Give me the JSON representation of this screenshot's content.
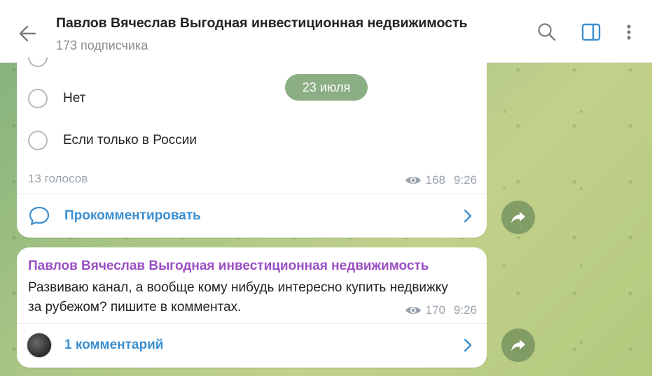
{
  "header": {
    "title": "Павлов Вячеслав Выгодная инвестиционная недвижимость",
    "subtitle": "173 подписчика"
  },
  "date_pill": "23 июля",
  "poll": {
    "options": [
      {
        "label": "Нет"
      },
      {
        "label": "Если только в России"
      }
    ],
    "votes": "13 голосов",
    "views": "168",
    "time": "9:26",
    "comment_label": "Прокомментировать"
  },
  "post": {
    "sender": "Павлов Вячеслав Выгодная инвестиционная недвижимость",
    "text": "Развиваю канал, а вообще кому нибудь интересно купить недвижку за рубежом? пишите в комментах.",
    "views": "170",
    "time": "9:26",
    "comment_label": "1 комментарий"
  },
  "colors": {
    "accent": "#3b8fd0",
    "sender": "#9a4fc4",
    "meta": "#9aa3ab"
  }
}
